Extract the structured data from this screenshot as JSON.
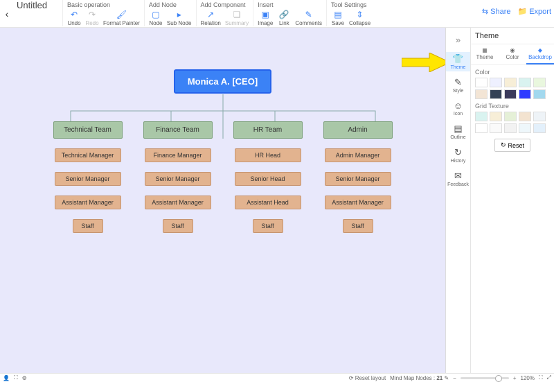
{
  "doc": {
    "title": "Untitled"
  },
  "toolbar": {
    "groups": [
      {
        "title": "Basic operation",
        "items": [
          {
            "name": "undo",
            "label": "Undo",
            "glyph": "↶"
          },
          {
            "name": "redo",
            "label": "Redo",
            "glyph": "↷",
            "disabled": true
          },
          {
            "name": "format-painter",
            "label": "Format Painter",
            "glyph": "🖌"
          }
        ]
      },
      {
        "title": "Add Node",
        "items": [
          {
            "name": "node",
            "label": "Node",
            "glyph": "▢"
          },
          {
            "name": "sub-node",
            "label": "Sub Node",
            "glyph": "▸"
          }
        ]
      },
      {
        "title": "Add Component",
        "items": [
          {
            "name": "relation",
            "label": "Relation",
            "glyph": "↗"
          },
          {
            "name": "summary",
            "label": "Summary",
            "glyph": "❏",
            "disabled": true
          }
        ]
      },
      {
        "title": "Insert",
        "items": [
          {
            "name": "image",
            "label": "Image",
            "glyph": "▣"
          },
          {
            "name": "link",
            "label": "Link",
            "glyph": "🔗"
          },
          {
            "name": "comments",
            "label": "Comments",
            "glyph": "✎"
          }
        ]
      },
      {
        "title": "Tool Settings",
        "items": [
          {
            "name": "save",
            "label": "Save",
            "glyph": "▤"
          },
          {
            "name": "collapse",
            "label": "Collapse",
            "glyph": "⇕"
          }
        ]
      }
    ],
    "share": "Share",
    "export": "Export"
  },
  "sidepanel": {
    "collapse_glyph": "»",
    "title": "Theme",
    "mini": [
      {
        "name": "theme",
        "label": "Theme",
        "glyph": "👕",
        "active": true
      },
      {
        "name": "style",
        "label": "Style",
        "glyph": "✎"
      },
      {
        "name": "icon",
        "label": "Icon",
        "glyph": "☺"
      },
      {
        "name": "outline",
        "label": "Outline",
        "glyph": "▤"
      },
      {
        "name": "history",
        "label": "History",
        "glyph": "↻"
      },
      {
        "name": "feedback",
        "label": "Feedback",
        "glyph": "✉"
      }
    ],
    "tabs": [
      {
        "name": "theme",
        "label": "Theme",
        "glyph": "▦"
      },
      {
        "name": "color",
        "label": "Color",
        "glyph": "◉"
      },
      {
        "name": "backdrop",
        "label": "Backdrop",
        "glyph": "◆",
        "active": true
      }
    ],
    "section_color": "Color",
    "colors": [
      "#ffffff",
      "#eef0ff",
      "#f7eed7",
      "#d9f3f0",
      "#e9f7de",
      "#f3e5d5",
      "#334155",
      "#3b3a5a",
      "#2f3bff",
      "#a2d8ee"
    ],
    "section_grid": "Grid Texture",
    "grids": [
      "#d9f3f0",
      "#f7eed7",
      "#e5f0d7",
      "#f3e3d0",
      "#eef3f7",
      "#ffffff",
      "#fafafa",
      "#f2f2f2",
      "#eef7fb",
      "#e3f0fb"
    ],
    "reset": "Reset"
  },
  "org": {
    "root": "Monica A. [CEO]",
    "columns": [
      {
        "dept": "Technical Team",
        "roles": [
          "Technical Manager",
          "Senior Manager",
          "Assistant Manager",
          "Staff"
        ]
      },
      {
        "dept": "Finance Team",
        "roles": [
          "Finance Manager",
          "Senior Manager",
          "Assistant Manager",
          "Staff"
        ]
      },
      {
        "dept": "HR Team",
        "roles": [
          "HR Head",
          "Senior Head",
          "Assistant Head",
          "Staff"
        ]
      },
      {
        "dept": "Admin",
        "roles": [
          "Admin Manager",
          "Senior Manager",
          "Assistant Manager",
          "Staff"
        ]
      }
    ]
  },
  "statusbar": {
    "reset_layout": "Reset layout",
    "nodes_label": "Mind Map Nodes :",
    "nodes_count": "21",
    "zoom_pct": "120%"
  }
}
